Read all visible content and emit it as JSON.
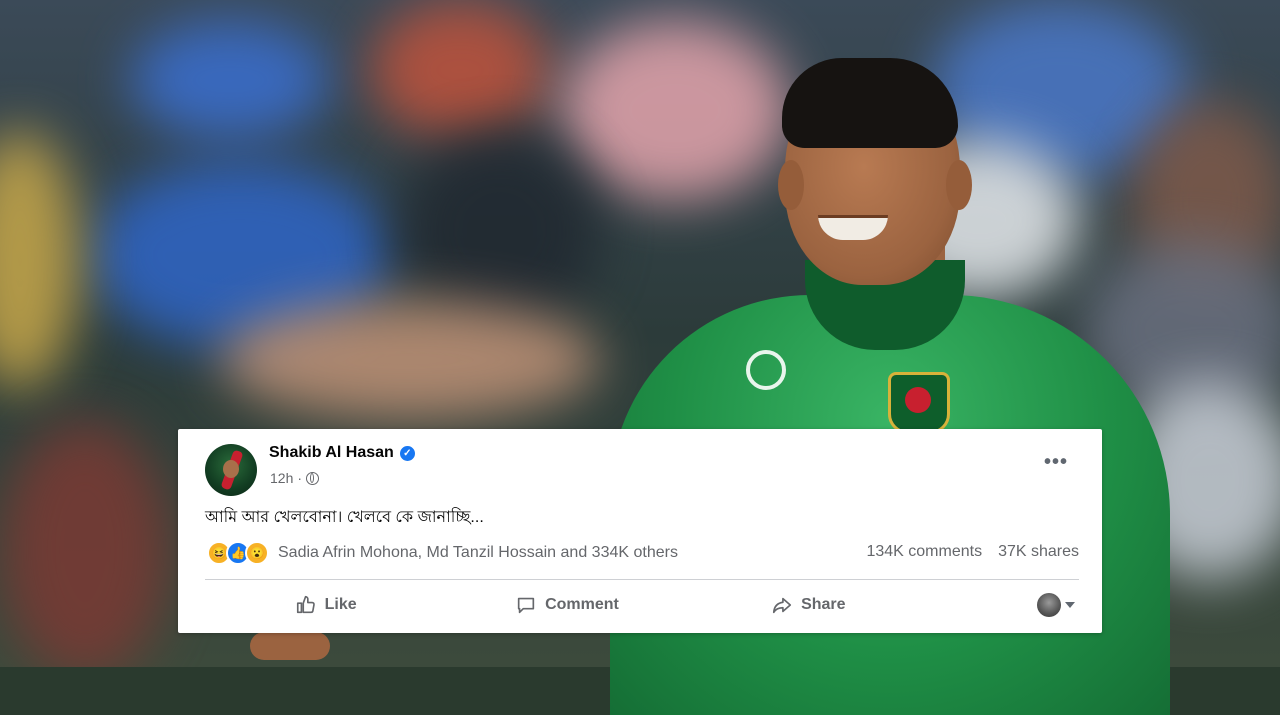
{
  "post": {
    "author_name": "Shakib Al Hasan",
    "verified_icon": "verified-badge-icon",
    "time": "12h",
    "separator": "·",
    "audience_icon": "globe-icon",
    "text": "আমি আর খেলবোনা। খেলবে কে জানাচ্ছি...",
    "more_icon": "•••"
  },
  "engagement": {
    "reaction_icons": [
      "haha-icon",
      "like-icon",
      "wow-icon"
    ],
    "reactions_summary": "Sadia Afrin Mohona, Md Tanzil Hossain and 334K others",
    "comments": "134K comments",
    "shares": "37K shares"
  },
  "actions": {
    "like_label": "Like",
    "comment_label": "Comment",
    "share_label": "Share"
  },
  "colors": {
    "accent": "#1877f2",
    "secondary_text": "#65676b",
    "jersey_green": "#1f8f46"
  }
}
